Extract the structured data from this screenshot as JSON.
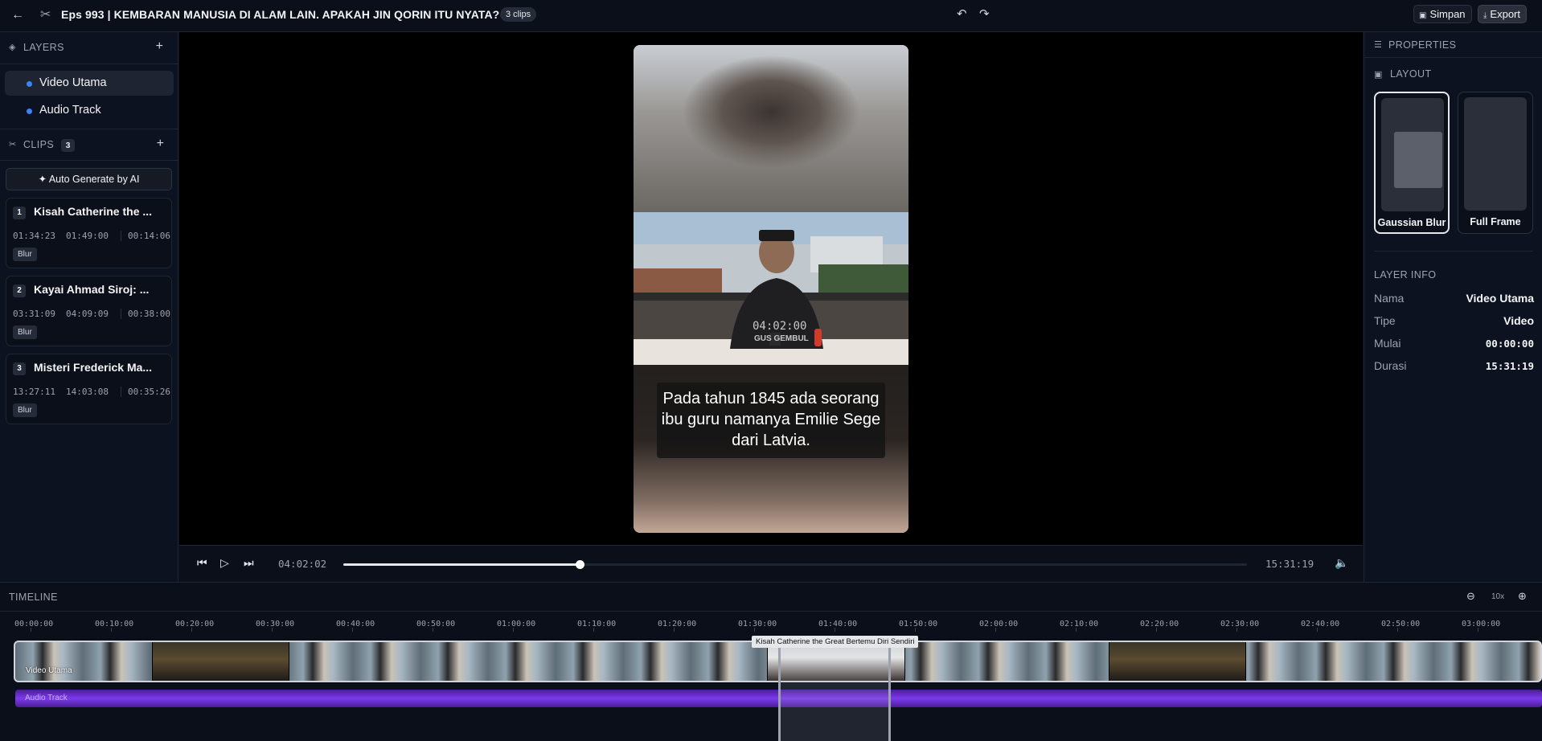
{
  "header": {
    "title": "Eps 993 | KEMBARAN MANUSIA DI ALAM LAIN. APAKAH JIN QORIN ITU NYATA?",
    "clips_badge": "3 clips",
    "save_label": "Simpan",
    "export_label": "Export"
  },
  "layers": {
    "heading": "LAYERS",
    "items": [
      {
        "label": "Video Utama",
        "active": true
      },
      {
        "label": "Audio Track",
        "active": false
      }
    ]
  },
  "clips": {
    "heading": "CLIPS",
    "count": "3",
    "auto_generate_label": "Auto Generate by AI",
    "items": [
      {
        "num": "1",
        "title": "Kisah Catherine the ...",
        "start": "01:34:23",
        "end": "01:49:00",
        "duration": "00:14:06",
        "tag": "Blur"
      },
      {
        "num": "2",
        "title": "Kayai Ahmad Siroj: ...",
        "start": "03:31:09",
        "end": "04:09:09",
        "duration": "00:38:00",
        "tag": "Blur"
      },
      {
        "num": "3",
        "title": "Misteri Frederick Ma...",
        "start": "13:27:11",
        "end": "14:03:08",
        "duration": "00:35:26",
        "tag": "Blur"
      }
    ]
  },
  "preview": {
    "caption": "Pada tahun 1845 ada seorang ibu guru namanya Emilie Sege dari Latvia.",
    "overlay_time": "04:02:00",
    "overlay_brand": "GUS GEMBUL"
  },
  "player": {
    "current_time": "04:02:02",
    "duration": "15:31:19",
    "progress": 0.262
  },
  "properties": {
    "heading": "PROPERTIES",
    "layout_heading": "LAYOUT",
    "layout_options": [
      {
        "label": "Gaussian Blur",
        "selected": true
      },
      {
        "label": "Full Frame",
        "selected": false
      }
    ],
    "layer_info_heading": "LAYER INFO",
    "layer_info": [
      {
        "key": "Nama",
        "value": "Video Utama",
        "mono": false
      },
      {
        "key": "Tipe",
        "value": "Video",
        "mono": false
      },
      {
        "key": "Mulai",
        "value": "00:00:00",
        "mono": true
      },
      {
        "key": "Durasi",
        "value": "15:31:19",
        "mono": true
      }
    ]
  },
  "timeline": {
    "heading": "TIMELINE",
    "zoom": "10x",
    "ticks": [
      "00:00:00",
      "00:10:00",
      "00:20:00",
      "00:30:00",
      "00:40:00",
      "00:50:00",
      "01:00:00",
      "01:10:00",
      "01:20:00",
      "01:30:00",
      "01:40:00",
      "01:50:00",
      "02:00:00",
      "02:10:00",
      "02:20:00",
      "02:30:00",
      "02:40:00",
      "02:50:00",
      "03:00:00"
    ],
    "video_track_label": "Video Utama",
    "audio_track_label": "Audio Track",
    "selected_clip_tooltip": "Kisah Catherine the Great Bertemu Diri Sendiri"
  },
  "icons": {
    "back": "arrow-left-icon",
    "cut": "scissors-icon",
    "undo": "undo-icon",
    "redo": "redo-icon",
    "layers": "layers-icon",
    "clips": "scissors-icon",
    "properties": "sliders-icon",
    "layout": "monitor-icon"
  },
  "colors": {
    "accent_dot": "#3b82f6",
    "audio_track": "#7c3aed",
    "background": "#0b0f1a"
  }
}
